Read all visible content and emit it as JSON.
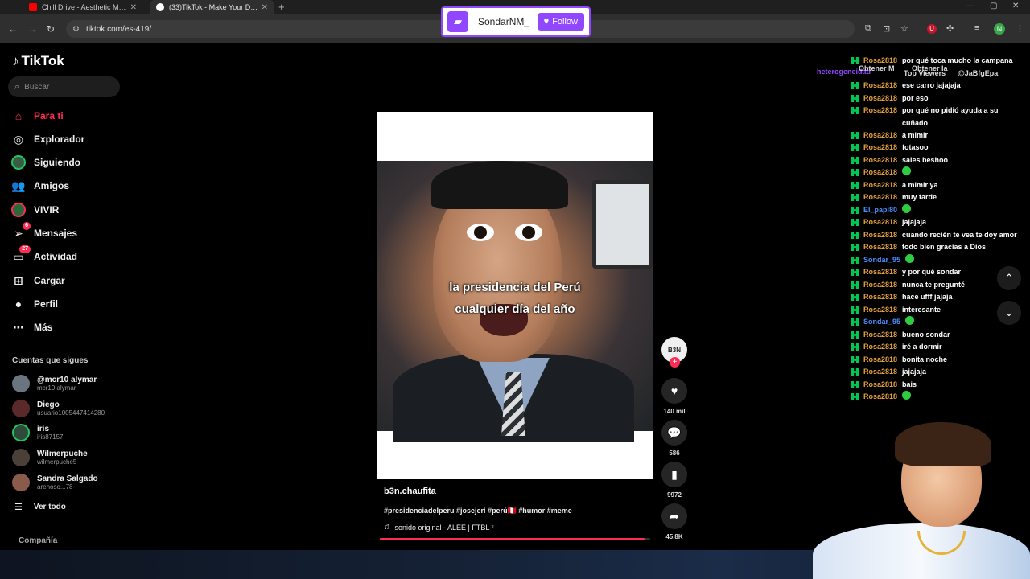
{
  "browser": {
    "tabs": [
      {
        "title": "Chill Drive - Aesthetic Musi",
        "favicon_color": "#ff0000",
        "active": false
      },
      {
        "title": "(33)TikTok - Make Your Day",
        "favicon_color": "#ffffff",
        "active": true
      }
    ],
    "url": "tiktok.com/es-419/"
  },
  "twitch_alert": {
    "username": "SondarNM_",
    "button_label": "Follow"
  },
  "sidebar": {
    "logo": "TikTok",
    "search_placeholder": "Buscar",
    "nav": [
      {
        "label": "Para ti",
        "icon": "home-icon",
        "active": true
      },
      {
        "label": "Explorador",
        "icon": "compass-icon"
      },
      {
        "label": "Siguiendo",
        "icon": "following-icon"
      },
      {
        "label": "Amigos",
        "icon": "friends-icon"
      },
      {
        "label": "VIVIR",
        "icon": "live-icon"
      },
      {
        "label": "Mensajes",
        "icon": "messages-icon",
        "badge": "6"
      },
      {
        "label": "Actividad",
        "icon": "activity-icon",
        "badge": "27"
      },
      {
        "label": "Cargar",
        "icon": "upload-icon"
      },
      {
        "label": "Perfil",
        "icon": "profile-icon"
      },
      {
        "label": "Más",
        "icon": "more-icon"
      }
    ],
    "following_title": "Cuentas que sigues",
    "following": [
      {
        "name": "@mcr10 alymar",
        "handle": "mcr10.alymar"
      },
      {
        "name": "Diego",
        "handle": "usuario1005447414280"
      },
      {
        "name": "iris",
        "handle": "iris87157"
      },
      {
        "name": "Wilmerpuche",
        "handle": "wilmerpuche5"
      },
      {
        "name": "Sandra Salgado",
        "handle": "arenoso...78"
      }
    ],
    "see_all": "Ver todo",
    "company": "Compañía"
  },
  "video": {
    "caption": [
      "la presidencia del Perú",
      "cualquier día del año"
    ],
    "author": "b3n.chaufita",
    "hashtags": "#presidenciadelperu #josejeri #perú🇵🇪 #humor #meme",
    "sound": "sonido original - ALEE | FTBL ⁷",
    "progress": 0.98,
    "creator_avatar_text": "B3N"
  },
  "actions": {
    "likes": "140 mil",
    "comments": "586",
    "saves": "9972",
    "shares": "45.8K"
  },
  "chat": {
    "header": {
      "left": "heterogeneidad",
      "mid1": "Obtener M",
      "mid2": "Obtener la",
      "top": "Top Viewers",
      "right": "@JaBfgEpa"
    },
    "messages": [
      {
        "user": "Rosa2818",
        "text": "por qué toca mucho la campana"
      },
      {
        "user": "Rosa2818",
        "text": "ese carro jajajaja"
      },
      {
        "user": "Rosa2818",
        "text": "por eso"
      },
      {
        "user": "Rosa2818",
        "text": "por qué no pidió ayuda a su cuñado"
      },
      {
        "user": "Rosa2818",
        "text": "a mimir"
      },
      {
        "user": "Rosa2818",
        "text": "fotasoo"
      },
      {
        "user": "Rosa2818",
        "text": "sales beshoo"
      },
      {
        "user": "Rosa2818",
        "text": "",
        "emote": true
      },
      {
        "user": "Rosa2818",
        "text": "a mimir ya"
      },
      {
        "user": "Rosa2818",
        "text": "muy tarde"
      },
      {
        "user": "El_papi80",
        "text": "",
        "emote": true,
        "blue": true
      },
      {
        "user": "Rosa2818",
        "text": "jajajaja"
      },
      {
        "user": "Rosa2818",
        "text": "cuando recién te vea te doy amor"
      },
      {
        "user": "Rosa2818",
        "text": "todo bien gracias a Dios"
      },
      {
        "user": "Sondar_95",
        "text": "",
        "emote": true,
        "blue": true
      },
      {
        "user": "Rosa2818",
        "text": "y por qué sondar"
      },
      {
        "user": "Rosa2818",
        "text": "nunca te pregunté"
      },
      {
        "user": "Rosa2818",
        "text": "hace ufff jajaja"
      },
      {
        "user": "Rosa2818",
        "text": "interesante"
      },
      {
        "user": "Sondar_95",
        "text": "",
        "emote": true,
        "blue": true
      },
      {
        "user": "Rosa2818",
        "text": "bueno sondar"
      },
      {
        "user": "Rosa2818",
        "text": "iré a dormir"
      },
      {
        "user": "Rosa2818",
        "text": "bonita noche"
      },
      {
        "user": "Rosa2818",
        "text": "jajajaja"
      },
      {
        "user": "Rosa2818",
        "text": "bais"
      },
      {
        "user": "Rosa2818",
        "text": "",
        "emote": true
      }
    ]
  }
}
